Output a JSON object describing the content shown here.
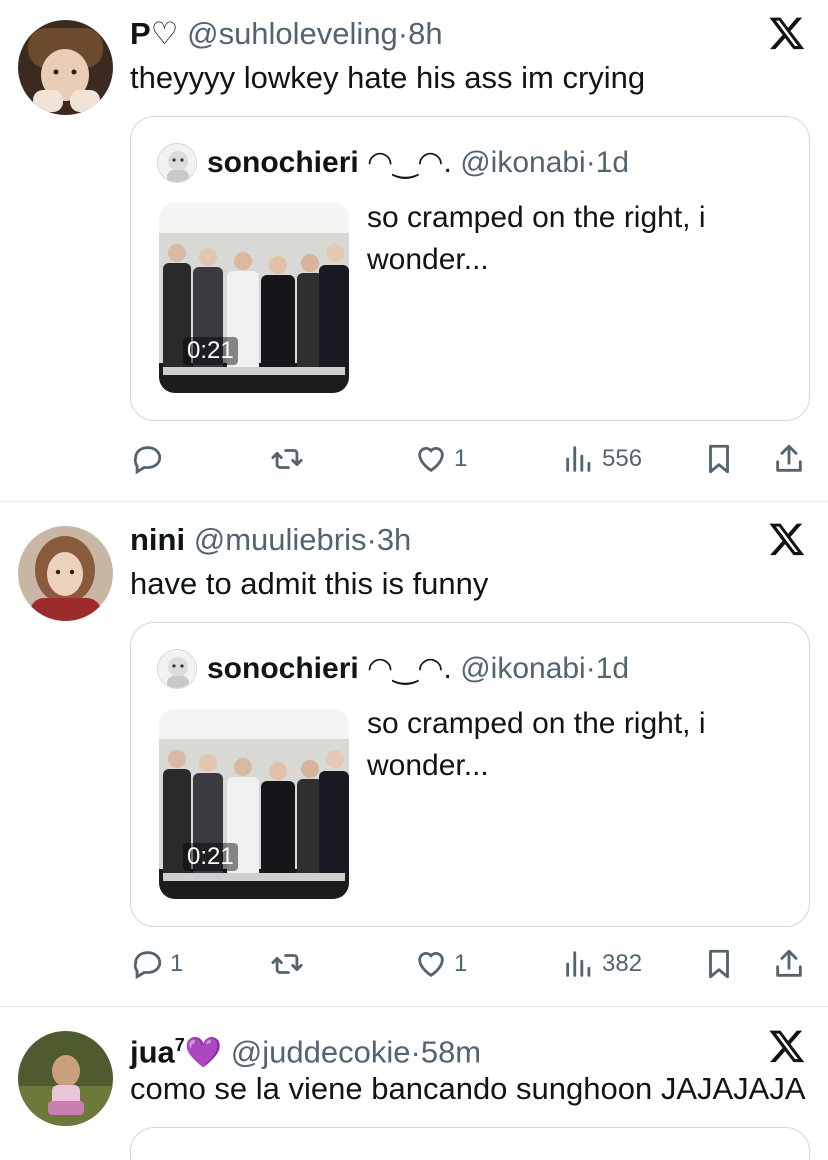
{
  "tweets": [
    {
      "name": "P♡",
      "handle": "@suhloleveling",
      "dot": "·",
      "time": "8h",
      "text": "theyyyy lowkey hate his ass im crying",
      "quote": {
        "name": "sonochieri",
        "emoticon": "◠‿◠.",
        "handle": "@ikonabi",
        "dot": "·",
        "time": "1d",
        "text": "so cramped on the right, i wonder...",
        "duration": "0:21"
      },
      "actions": {
        "replies": "",
        "reposts": "",
        "likes": "1",
        "views": "556"
      }
    },
    {
      "name": "nini",
      "handle": "@muuliebris",
      "dot": "·",
      "time": "3h",
      "text": "have to admit this is funny",
      "quote": {
        "name": "sonochieri",
        "emoticon": "◠‿◠.",
        "handle": "@ikonabi",
        "dot": "·",
        "time": "1d",
        "text": "so cramped on the right, i wonder...",
        "duration": "0:21"
      },
      "actions": {
        "replies": "1",
        "reposts": "",
        "likes": "1",
        "views": "382"
      }
    },
    {
      "name": "jua",
      "name_sup": "7",
      "name_emoji": "💜",
      "handle": "@juddecokie",
      "dot": "·",
      "time": "58m",
      "text": "como se la viene bancando sunghoon JAJAJAJA"
    }
  ],
  "icons": {
    "reply": "reply-icon",
    "repost": "repost-icon",
    "like": "heart-icon",
    "views": "views-icon",
    "bookmark": "bookmark-icon",
    "share": "share-icon",
    "x_logo": "x-logo-icon"
  },
  "colors": {
    "text": "#0f1419",
    "secondary": "#536471",
    "border": "#cfd9de",
    "divider": "#e6e8ea",
    "emoji_heart": "#8e2de2"
  }
}
